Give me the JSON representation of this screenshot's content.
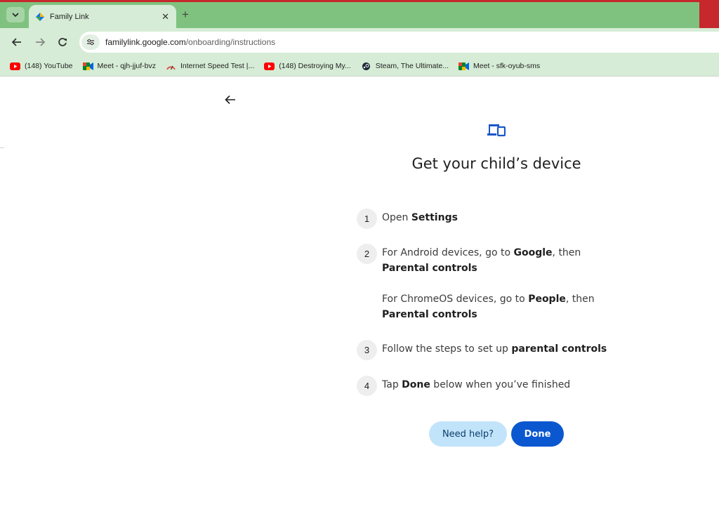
{
  "browser": {
    "tab": {
      "title": "Family Link"
    },
    "url": {
      "domain": "familylink.google.com",
      "path": "/onboarding/instructions"
    },
    "bookmarks": [
      {
        "label": "(148) YouTube",
        "icon": "youtube-icon"
      },
      {
        "label": "Meet - qjh-jjuf-bvz",
        "icon": "meet-icon"
      },
      {
        "label": "Internet Speed Test |...",
        "icon": "speedtest-icon"
      },
      {
        "label": "(148) Destroying My...",
        "icon": "youtube-icon"
      },
      {
        "label": "Steam, The Ultimate...",
        "icon": "steam-icon"
      },
      {
        "label": "Meet - sfk-oyub-sms",
        "icon": "meet-icon"
      }
    ]
  },
  "page": {
    "heading": "Get your child’s device",
    "steps": [
      {
        "number": "1",
        "parts": [
          "Open ",
          "Settings"
        ]
      },
      {
        "number": "2",
        "parts": [
          "For Android devices, go to ",
          "Google",
          ", then ",
          "Parental controls"
        ]
      },
      {
        "number": "",
        "parts": [
          "For ChromeOS devices, go to ",
          "People",
          ", then ",
          "Parental controls"
        ]
      },
      {
        "number": "3",
        "parts": [
          "Follow the steps to set up ",
          "parental controls"
        ]
      },
      {
        "number": "4",
        "parts": [
          "Tap ",
          "Done",
          " below when you’ve finished"
        ]
      }
    ],
    "buttons": {
      "help": "Need help?",
      "done": "Done"
    }
  },
  "colors": {
    "primary": "#0b57d0",
    "help_bg": "#c2e4fa",
    "chrome_green": "#7fc27f"
  }
}
